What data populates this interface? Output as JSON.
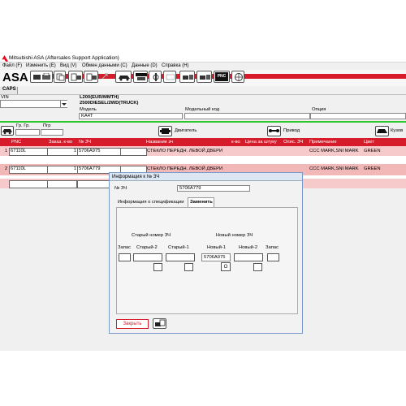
{
  "window": {
    "title": "Mitsubishi ASA (Aftersales Support Application)"
  },
  "menu": [
    "Файл (F)",
    "Изменить (E)",
    "Вид (V)",
    "Обмен данными (C)",
    "Данные (D)",
    "Справка (H)"
  ],
  "toolbar": {
    "logo": "ASA",
    "pnc_label": "PNC",
    "caps_tab": "CAPS"
  },
  "vehicle": {
    "vin_label": "VIN",
    "vin_value": "",
    "line1": "L200(EUR/MMTH)",
    "line2": "2500DIESEL/2WD(TRUCK)",
    "model_label": "Модель",
    "model_value": "KA4T",
    "model_code_label": "Модельный код",
    "model_code_value": "",
    "option_label": "Опция",
    "option_value": ""
  },
  "groups": {
    "gr_label": "Гр. Гр.",
    "pgr_label": "Пгр",
    "engine": "Двигатель",
    "drive": "Привод",
    "body": "Кузов"
  },
  "grid": {
    "headers": [
      "PNC",
      "Заказ. к-во",
      "№ ЗЧ",
      "Название зч",
      "к-во",
      "Цена за штуку",
      "Опис. ЗЧ",
      "Примечание",
      "Цвет"
    ],
    "rows": [
      {
        "num": "1",
        "pnc": "67110L",
        "qty": "1",
        "part": "5706A975",
        "name": "СТЕКЛО ПЕРЕДН. ЛЕВОЙ ДВЕРИ",
        "note": "CCC MARK,SNI MARK",
        "color": "GREEN"
      },
      {
        "num": "2",
        "pnc": "67110L",
        "qty": "1",
        "part": "5706A779",
        "name": "СТЕКЛО ПЕРЕДН. ЛЕВОЙ ДВЕРИ",
        "note": "CCC MARK,SNI MARK",
        "color": "GREEN"
      }
    ]
  },
  "dialog": {
    "title": "Информация к № ЗЧ",
    "part_label": "№ ЗЧ",
    "part_value": "5706A779",
    "tab_spec": "Информация о спецификации",
    "tab_replace": "Заменить",
    "old_header": "Старый номер ЗЧ",
    "new_header": "Новый номер ЗЧ",
    "col_stock_left": "Запас",
    "col_old2": "Старый-2",
    "col_old1": "Старый-1",
    "col_new1": "Новый-1",
    "col_new2": "Новый-2",
    "col_stock_right": "Запас",
    "new1_value": "5706A975",
    "o_button": "O",
    "close_button": "Закрыть"
  }
}
